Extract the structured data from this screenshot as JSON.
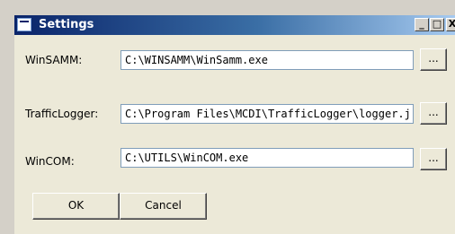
{
  "window": {
    "title": "Settings",
    "minimize_glyph": "_",
    "maximize_glyph": "□",
    "close_glyph": "X"
  },
  "rows": [
    {
      "label": "WinSAMM:",
      "value": "C:\\WINSAMM\\WinSamm.exe",
      "browse_label": "..."
    },
    {
      "label": "TrafficLogger:",
      "value": "C:\\Program Files\\MCDI\\TrafficLogger\\logger.j",
      "browse_label": "..."
    },
    {
      "label": "WinCOM:",
      "value": "C:\\UTILS\\WinCOM.exe",
      "browse_label": "..."
    }
  ],
  "buttons": {
    "ok_label": "OK",
    "cancel_label": "Cancel"
  }
}
